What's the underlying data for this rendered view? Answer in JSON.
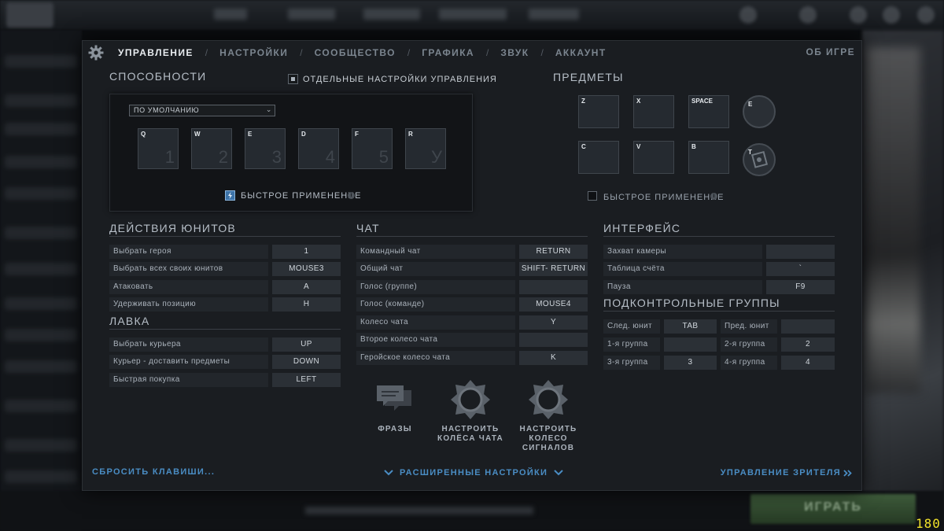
{
  "topbar": {
    "play_label": "ИГРАТЬ",
    "fps": "180"
  },
  "dialog": {
    "tabs": [
      "УПРАВЛЕНИЕ",
      "НАСТРОЙКИ",
      "СООБЩЕСТВО",
      "ГРАФИКА",
      "ЗВУК",
      "АККАУНТ"
    ],
    "active_tab": "УПРАВЛЕНИЕ",
    "about": "ОБ ИГРЕ"
  },
  "abilities": {
    "title": "СПОСОБНОСТИ",
    "separate_controls_label": "ОТДЕЛЬНЫЕ НАСТРОЙКИ УПРАВЛЕНИЯ",
    "preset": "ПО УМОЛЧАНИЮ",
    "slots": [
      {
        "key": "Q",
        "num": "1"
      },
      {
        "key": "W",
        "num": "2"
      },
      {
        "key": "E",
        "num": "3"
      },
      {
        "key": "D",
        "num": "4"
      },
      {
        "key": "F",
        "num": "5"
      },
      {
        "key": "R",
        "num": "У"
      }
    ],
    "quick_cast": "БЫСТРОЕ ПРИМЕНЕНИЕ"
  },
  "items": {
    "title": "ПРЕДМЕТЫ",
    "row1": [
      "Z",
      "X",
      "SPACE"
    ],
    "row2": [
      "C",
      "V",
      "B"
    ],
    "round1": "E",
    "round2": "T",
    "quick_cast": "БЫСТРОЕ ПРИМЕНЕНИЕ"
  },
  "unit_actions": {
    "title": "ДЕЙСТВИЯ ЮНИТОВ",
    "rows": [
      {
        "label": "Выбрать героя",
        "key": "1"
      },
      {
        "label": "Выбрать всех своих юнитов",
        "key": "MOUSE3"
      },
      {
        "label": "Атаковать",
        "key": "A"
      },
      {
        "label": "Удерживать позицию",
        "key": "H"
      }
    ]
  },
  "shop": {
    "title": "ЛАВКА",
    "rows": [
      {
        "label": "Выбрать курьера",
        "key": "UP"
      },
      {
        "label": "Курьер - доставить предметы",
        "key": "DOWN"
      },
      {
        "label": "Быстрая покупка",
        "key": "LEFT"
      }
    ]
  },
  "chat": {
    "title": "ЧАТ",
    "rows": [
      {
        "label": "Командный чат",
        "key": "RETURN"
      },
      {
        "label": "Общий чат",
        "key": "SHIFT- RETURN"
      },
      {
        "label": "Голос (группе)",
        "key": ""
      },
      {
        "label": "Голос (команде)",
        "key": "MOUSE4"
      },
      {
        "label": "Колесо чата",
        "key": "Y"
      },
      {
        "label": "Второе колесо чата",
        "key": ""
      },
      {
        "label": "Геройское колесо чата",
        "key": "K"
      }
    ],
    "phrases": "ФРАЗЫ",
    "configure_chat_wheels": [
      "НАСТРОИТЬ",
      "КОЛЁСА ЧАТА"
    ],
    "configure_ping_wheel": [
      "НАСТРОИТЬ",
      "КОЛЕСО",
      "СИГНАЛОВ"
    ]
  },
  "interface": {
    "title": "ИНТЕРФЕЙС",
    "rows": [
      {
        "label": "Захват камеры",
        "key": ""
      },
      {
        "label": "Таблица счёта",
        "key": "`"
      },
      {
        "label": "Пауза",
        "key": "F9"
      }
    ]
  },
  "control_groups": {
    "title": "ПОДКОНТРОЛЬНЫЕ ГРУППЫ",
    "rows": [
      {
        "l1": "След. юнит",
        "k1": "TAB",
        "l2": "Пред. юнит",
        "k2": ""
      },
      {
        "l1": "1-я группа",
        "k1": "",
        "l2": "2-я группа",
        "k2": "2"
      },
      {
        "l1": "3-я группа",
        "k1": "3",
        "l2": "4-я группа",
        "k2": "4"
      }
    ]
  },
  "footer": {
    "reset": "СБРОСИТЬ КЛАВИШИ...",
    "advanced": "РАСШИРЕННЫЕ НАСТРОЙКИ",
    "spectator": "УПРАВЛЕНИЕ ЗРИТЕЛЯ"
  }
}
